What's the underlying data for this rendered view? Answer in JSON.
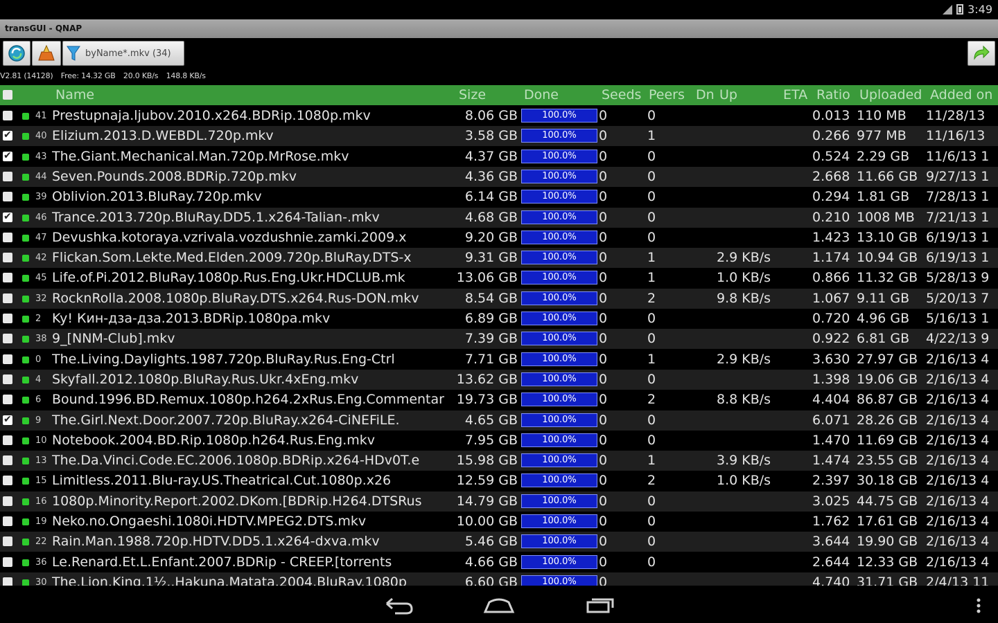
{
  "status": {
    "time": "3:49"
  },
  "window": {
    "title": "transGUI - QNAP"
  },
  "toolbar": {
    "filter_label": "byName*.mkv (34)"
  },
  "info": {
    "version": "V2.81 (14128)",
    "free": "Free: 14.32 GB",
    "down": "20.0 KB/s",
    "up": "148.8 KB/s"
  },
  "columns": {
    "name": "Name",
    "size": "Size",
    "done": "Done",
    "seeds": "Seeds",
    "peers": "Peers",
    "dn": "Dn",
    "up": "Up",
    "eta": "ETA",
    "ratio": "Ratio",
    "uploaded": "Uploaded",
    "added": "Added on"
  },
  "torrents": [
    {
      "checked": false,
      "num": "41",
      "name": "Prestupnaja.ljubov.2010.x264.BDRip.1080p.mkv",
      "size": "8.06 GB",
      "done": "100.0%",
      "seeds": "0",
      "peers": "0",
      "up": "",
      "ratio": "0.013",
      "uploaded": "110 MB",
      "added": "11/28/13"
    },
    {
      "checked": true,
      "num": "40",
      "name": "Elizium.2013.D.WEBDL.720p.mkv",
      "size": "3.58 GB",
      "done": "100.0%",
      "seeds": "0",
      "peers": "1",
      "up": "",
      "ratio": "0.266",
      "uploaded": "977 MB",
      "added": "11/16/13"
    },
    {
      "checked": true,
      "num": "43",
      "name": "The.Giant.Mechanical.Man.720p.MrRose.mkv",
      "size": "4.37 GB",
      "done": "100.0%",
      "seeds": "0",
      "peers": "0",
      "up": "",
      "ratio": "0.524",
      "uploaded": "2.29 GB",
      "added": "11/6/13 1"
    },
    {
      "checked": false,
      "num": "44",
      "name": "Seven.Pounds.2008.BDRip.720p.mkv",
      "size": "4.36 GB",
      "done": "100.0%",
      "seeds": "0",
      "peers": "0",
      "up": "",
      "ratio": "2.668",
      "uploaded": "11.66 GB",
      "added": "9/27/13 1"
    },
    {
      "checked": false,
      "num": "39",
      "name": "Oblivion.2013.BluRay.720p.mkv",
      "size": "6.14 GB",
      "done": "100.0%",
      "seeds": "0",
      "peers": "0",
      "up": "",
      "ratio": "0.294",
      "uploaded": "1.81 GB",
      "added": "7/28/13 1"
    },
    {
      "checked": true,
      "num": "46",
      "name": "Trance.2013.720p.BluRay.DD5.1.x264-Talian-.mkv",
      "size": "4.68 GB",
      "done": "100.0%",
      "seeds": "0",
      "peers": "0",
      "up": "",
      "ratio": "0.210",
      "uploaded": "1008 MB",
      "added": "7/21/13 1"
    },
    {
      "checked": false,
      "num": "47",
      "name": "Devushka.kotoraya.vzrivala.vozdushnie.zamki.2009.x",
      "size": "9.20 GB",
      "done": "100.0%",
      "seeds": "0",
      "peers": "0",
      "up": "",
      "ratio": "1.423",
      "uploaded": "13.10 GB",
      "added": "6/19/13 1"
    },
    {
      "checked": false,
      "num": "42",
      "name": "Flickan.Som.Lekte.Med.Elden.2009.720p.BluRay.DTS-x",
      "size": "9.31 GB",
      "done": "100.0%",
      "seeds": "0",
      "peers": "1",
      "up": "2.9 KB/s",
      "ratio": "1.174",
      "uploaded": "10.94 GB",
      "added": "6/19/13 1"
    },
    {
      "checked": false,
      "num": "45",
      "name": "Life.of.Pi.2012.BluRay.1080p.Rus.Eng.Ukr.HDCLUB.mk",
      "size": "13.06 GB",
      "done": "100.0%",
      "seeds": "0",
      "peers": "1",
      "up": "1.0 KB/s",
      "ratio": "0.866",
      "uploaded": "11.32 GB",
      "added": "5/28/13 9"
    },
    {
      "checked": false,
      "num": "32",
      "name": "RocknRolla.2008.1080p.BluRay.DTS.x264.Rus-DON.mkv",
      "size": "8.54 GB",
      "done": "100.0%",
      "seeds": "0",
      "peers": "2",
      "up": "9.8 KB/s",
      "ratio": "1.067",
      "uploaded": "9.11 GB",
      "added": "5/20/13 7"
    },
    {
      "checked": false,
      "num": "2",
      "name": "Ky! Кин-дза-дза.2013.BDRip.1080pa.mkv",
      "size": "6.89 GB",
      "done": "100.0%",
      "seeds": "0",
      "peers": "0",
      "up": "",
      "ratio": "0.720",
      "uploaded": "4.96 GB",
      "added": "5/16/13 1"
    },
    {
      "checked": false,
      "num": "38",
      "name": "9_[NNM-Club].mkv",
      "size": "7.39 GB",
      "done": "100.0%",
      "seeds": "0",
      "peers": "0",
      "up": "",
      "ratio": "0.922",
      "uploaded": "6.81 GB",
      "added": "4/22/13 9"
    },
    {
      "checked": false,
      "num": "0",
      "name": "The.Living.Daylights.1987.720p.BluRay.Rus.Eng-Ctrl",
      "size": "7.71 GB",
      "done": "100.0%",
      "seeds": "0",
      "peers": "1",
      "up": "2.9 KB/s",
      "ratio": "3.630",
      "uploaded": "27.97 GB",
      "added": "2/16/13 4"
    },
    {
      "checked": false,
      "num": "4",
      "name": "Skyfall.2012.1080p.BluRay.Rus.Ukr.4xEng.mkv",
      "size": "13.62 GB",
      "done": "100.0%",
      "seeds": "0",
      "peers": "0",
      "up": "",
      "ratio": "1.398",
      "uploaded": "19.06 GB",
      "added": "2/16/13 4"
    },
    {
      "checked": false,
      "num": "6",
      "name": "Bound.1996.BD.Remux.1080p.h264.2xRus.Eng.Commentar",
      "size": "19.73 GB",
      "done": "100.0%",
      "seeds": "0",
      "peers": "2",
      "up": "8.8 KB/s",
      "ratio": "4.404",
      "uploaded": "86.87 GB",
      "added": "2/16/13 4"
    },
    {
      "checked": true,
      "num": "9",
      "name": "The.Girl.Next.Door.2007.720p.BluRay.x264-CiNEFiLE.",
      "size": "4.65 GB",
      "done": "100.0%",
      "seeds": "0",
      "peers": "0",
      "up": "",
      "ratio": "6.071",
      "uploaded": "28.26 GB",
      "added": "2/16/13 4"
    },
    {
      "checked": false,
      "num": "10",
      "name": "Notebook.2004.BD.Rip.1080p.h264.Rus.Eng.mkv",
      "size": "7.95 GB",
      "done": "100.0%",
      "seeds": "0",
      "peers": "0",
      "up": "",
      "ratio": "1.470",
      "uploaded": "11.69 GB",
      "added": "2/16/13 4"
    },
    {
      "checked": false,
      "num": "13",
      "name": "The.Da.Vinci.Code.EC.2006.1080p.BDRip.x264-HDv0T.e",
      "size": "15.98 GB",
      "done": "100.0%",
      "seeds": "0",
      "peers": "1",
      "up": "3.9 KB/s",
      "ratio": "1.474",
      "uploaded": "23.55 GB",
      "added": "2/16/13 4"
    },
    {
      "checked": false,
      "num": "15",
      "name": "Limitless.2011.Blu-ray.US.Theatrical.Cut.1080p.x26",
      "size": "12.59 GB",
      "done": "100.0%",
      "seeds": "0",
      "peers": "2",
      "up": "1.0 KB/s",
      "ratio": "2.397",
      "uploaded": "30.18 GB",
      "added": "2/16/13 4"
    },
    {
      "checked": false,
      "num": "16",
      "name": "1080p.Minority.Report.2002.DKom.[BDRip.H264.DTSRus",
      "size": "14.79 GB",
      "done": "100.0%",
      "seeds": "0",
      "peers": "0",
      "up": "",
      "ratio": "3.025",
      "uploaded": "44.75 GB",
      "added": "2/16/13 4"
    },
    {
      "checked": false,
      "num": "19",
      "name": "Neko.no.Ongaeshi.1080i.HDTV.MPEG2.DTS.mkv",
      "size": "10.00 GB",
      "done": "100.0%",
      "seeds": "0",
      "peers": "0",
      "up": "",
      "ratio": "1.762",
      "uploaded": "17.61 GB",
      "added": "2/16/13 4"
    },
    {
      "checked": false,
      "num": "22",
      "name": "Rain.Man.1988.720p.HDTV.DD5.1.x264-dxva.mkv",
      "size": "5.46 GB",
      "done": "100.0%",
      "seeds": "0",
      "peers": "0",
      "up": "",
      "ratio": "3.644",
      "uploaded": "19.90 GB",
      "added": "2/16/13 4"
    },
    {
      "checked": false,
      "num": "36",
      "name": "Le.Renard.Et.L.Enfant.2007.BDRip - CREEP.[torrents",
      "size": "4.66 GB",
      "done": "100.0%",
      "seeds": "0",
      "peers": "0",
      "up": "",
      "ratio": "2.644",
      "uploaded": "12.33 GB",
      "added": "2/16/13 4"
    },
    {
      "checked": false,
      "num": "30",
      "name": "The.Lion.King.1½..Hakuna.Matata.2004.BluRay.1080p",
      "size": "6.60 GB",
      "done": "100.0%",
      "seeds": "0",
      "peers": "",
      "up": "",
      "ratio": "4.740",
      "uploaded": "31.71 GB",
      "added": "2/4/13 11"
    }
  ]
}
